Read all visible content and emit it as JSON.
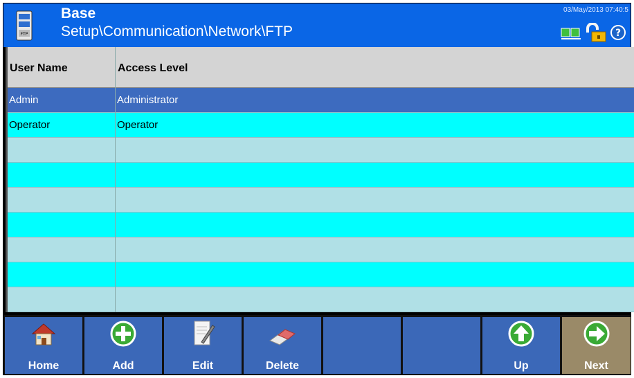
{
  "header": {
    "title": "Base",
    "path": "Setup\\Communication\\Network\\FTP",
    "datetime": "03/May/2013 07:40:5",
    "app_icon": "ftp-icon",
    "status_icons": [
      "network-icon",
      "unlocked-padlock-icon",
      "help-icon"
    ]
  },
  "table": {
    "columns": [
      "User Name",
      "Access Level"
    ],
    "rows": [
      {
        "user": "Admin",
        "level": "Administrator"
      },
      {
        "user": "Operator",
        "level": "Operator"
      },
      {
        "user": "",
        "level": ""
      },
      {
        "user": "",
        "level": ""
      },
      {
        "user": "",
        "level": ""
      },
      {
        "user": "",
        "level": ""
      },
      {
        "user": "",
        "level": ""
      },
      {
        "user": "",
        "level": ""
      },
      {
        "user": "",
        "level": ""
      }
    ]
  },
  "toolbar": {
    "home": "Home",
    "add": "Add",
    "edit": "Edit",
    "delete": "Delete",
    "empty1": "",
    "empty2": "",
    "up": "Up",
    "next": "Next"
  },
  "colors": {
    "header": "#0a66e6",
    "selected_row": "#3d6bbf",
    "row_cyan": "#00ffff",
    "row_light": "#b0e0e6",
    "button": "#3b68b8",
    "button_next": "#9a8a68"
  }
}
